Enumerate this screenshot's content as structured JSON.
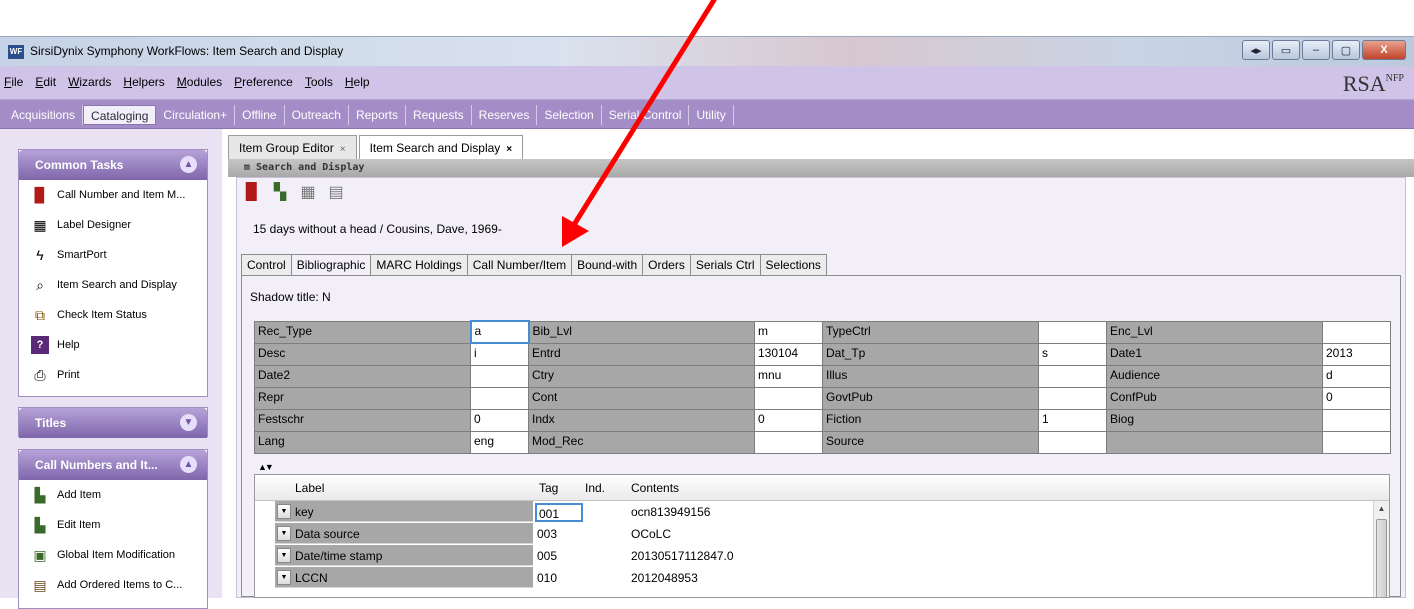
{
  "window": {
    "app_icon": "WF",
    "title": "SirsiDynix Symphony WorkFlows: Item Search and Display",
    "buttons": [
      "◂▸",
      "▭",
      "–",
      "▢",
      "X"
    ]
  },
  "menu": {
    "items": [
      {
        "label": "File"
      },
      {
        "label": "Edit"
      },
      {
        "label": "Wizards"
      },
      {
        "label": "Helpers"
      },
      {
        "label": "Modules"
      },
      {
        "label": "Preference"
      },
      {
        "label": "Tools"
      },
      {
        "label": "Help"
      }
    ],
    "brand": "RSA",
    "brand_sup": "NFP"
  },
  "modules": [
    {
      "label": "Acquisitions"
    },
    {
      "label": "Cataloging"
    },
    {
      "label": "Circulation+"
    },
    {
      "label": "Offline"
    },
    {
      "label": "Outreach"
    },
    {
      "label": "Reports"
    },
    {
      "label": "Requests"
    },
    {
      "label": "Reserves"
    },
    {
      "label": "Selection"
    },
    {
      "label": "Serial Control"
    },
    {
      "label": "Utility"
    }
  ],
  "active_module": "Cataloging",
  "sidebar": {
    "common_tasks": {
      "title": "Common Tasks",
      "items": [
        {
          "label": "Call Number and Item M...",
          "icon": "books-icon"
        },
        {
          "label": "Label Designer",
          "icon": "barcode-icon"
        },
        {
          "label": "SmartPort",
          "icon": "lightning-icon"
        },
        {
          "label": "Item Search and Display",
          "icon": "search-book-icon"
        },
        {
          "label": "Check Item Status",
          "icon": "check-status-icon"
        },
        {
          "label": "Help",
          "icon": "help-icon"
        },
        {
          "label": "Print",
          "icon": "printer-icon"
        }
      ]
    },
    "titles": {
      "title": "Titles"
    },
    "call_numbers": {
      "title": "Call Numbers and It...",
      "items": [
        {
          "label": "Add Item",
          "icon": "add-item-icon"
        },
        {
          "label": "Edit Item",
          "icon": "edit-item-icon"
        },
        {
          "label": "Global Item Modification",
          "icon": "global-modify-icon"
        },
        {
          "label": "Add Ordered Items to C...",
          "icon": "add-ordered-icon"
        }
      ]
    }
  },
  "doc_tabs": [
    {
      "label": "Item Group Editor",
      "active": false
    },
    {
      "label": "Item Search and Display",
      "active": true
    }
  ],
  "pane_title": "m Search and Display",
  "record_title": "15 days without a head / Cousins, Dave, 1969-",
  "subtabs": [
    {
      "label": "Control"
    },
    {
      "label": "Bibliographic"
    },
    {
      "label": "MARC Holdings"
    },
    {
      "label": "Call Number/Item"
    },
    {
      "label": "Bound-with"
    },
    {
      "label": "Orders"
    },
    {
      "label": "Serials Ctrl"
    },
    {
      "label": "Selections"
    }
  ],
  "active_subtab": "Bibliographic",
  "shadow_title": "Shadow title:  N",
  "fixed_fields": [
    [
      [
        "Rec_Type",
        "a"
      ],
      [
        "Bib_Lvl",
        "m"
      ],
      [
        "TypeCtrl",
        ""
      ],
      [
        "Enc_Lvl",
        ""
      ]
    ],
    [
      [
        "Desc",
        "i"
      ],
      [
        "Entrd",
        "130104"
      ],
      [
        "Dat_Tp",
        "s"
      ],
      [
        "Date1",
        "2013"
      ]
    ],
    [
      [
        "Date2",
        ""
      ],
      [
        "Ctry",
        "mnu"
      ],
      [
        "Illus",
        ""
      ],
      [
        "Audience",
        "d"
      ]
    ],
    [
      [
        "Repr",
        ""
      ],
      [
        "Cont",
        ""
      ],
      [
        "GovtPub",
        ""
      ],
      [
        "ConfPub",
        "0"
      ]
    ],
    [
      [
        "Festschr",
        "0"
      ],
      [
        "Indx",
        "0"
      ],
      [
        "Fiction",
        "1"
      ],
      [
        "Biog",
        ""
      ]
    ],
    [
      [
        "Lang",
        "eng"
      ],
      [
        "Mod_Rec",
        ""
      ],
      [
        "Source",
        ""
      ],
      [
        "",
        ""
      ]
    ]
  ],
  "tag_grid": {
    "headers": {
      "label": "Label",
      "tag": "Tag",
      "ind": "Ind.",
      "contents": "Contents"
    },
    "rows": [
      {
        "label": "key",
        "tag": "001",
        "ind": "",
        "contents": "ocn813949156"
      },
      {
        "label": "Data source",
        "tag": "003",
        "ind": "",
        "contents": "OCoLC"
      },
      {
        "label": "Date/time stamp",
        "tag": "005",
        "ind": "",
        "contents": "20130517112847.0"
      },
      {
        "label": "LCCN",
        "tag": "010",
        "ind": "",
        "contents": " 2012048953"
      }
    ]
  },
  "colors": {
    "menu_bg": "#cfc4e8",
    "module_bar": "#a48cc6",
    "annotation_arrow": "#ff0000"
  }
}
